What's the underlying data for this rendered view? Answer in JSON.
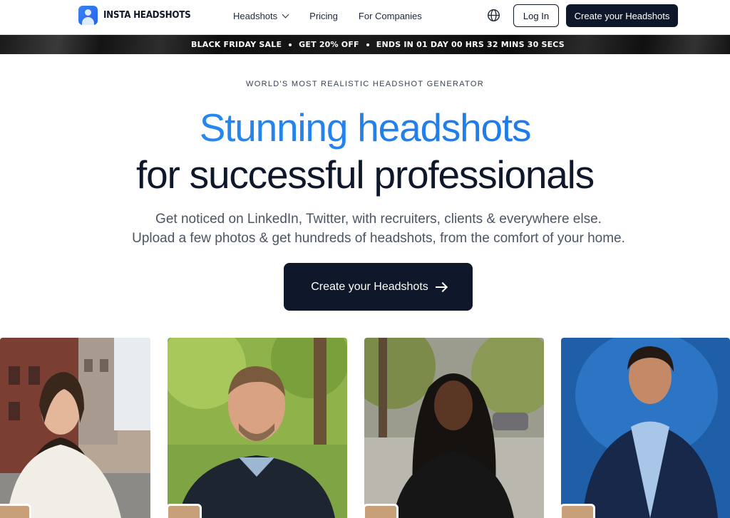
{
  "brand": {
    "name": "INSTA HEADSHOTS",
    "accent": "#2b8ff0"
  },
  "nav": {
    "links": [
      {
        "label": "Headshots",
        "has_dropdown": true
      },
      {
        "label": "Pricing"
      },
      {
        "label": "For Companies"
      }
    ],
    "language_icon": "globe-icon",
    "login_label": "Log In",
    "create_label": "Create your Headshots"
  },
  "banner": {
    "part1": "BLACK FRIDAY SALE",
    "part2": "GET 20% OFF",
    "part3": "ENDS IN 01 DAY 00 HRS 32 MINS 30 SECS"
  },
  "hero": {
    "eyebrow": "WORLD'S MOST REALISTIC HEADSHOT GENERATOR",
    "title_line1": "Stunning headshots",
    "title_line2": "for successful professionals",
    "subtitle_line1": "Get noticed on LinkedIn, Twitter, with recruiters, clients & everywhere else.",
    "subtitle_line2": "Upload a few photos & get hundreds of headshots, from the comfort of your home.",
    "cta_label": "Create your Headshots"
  },
  "gallery": {
    "photos": [
      {
        "icon": "portrait-woman-city-image"
      },
      {
        "icon": "portrait-man-park-image"
      },
      {
        "icon": "portrait-woman-street-image"
      },
      {
        "icon": "portrait-man-blue-backdrop-image"
      }
    ]
  }
}
